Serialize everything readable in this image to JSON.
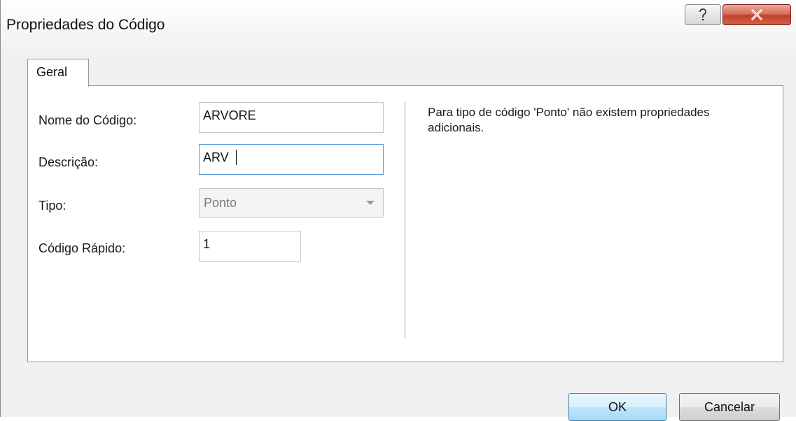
{
  "window": {
    "title": "Propriedades do Código",
    "help_icon": "question-mark-icon",
    "close_icon": "close-x-icon"
  },
  "tabs": [
    {
      "label": "Geral",
      "active": true
    }
  ],
  "form": {
    "nome_label": "Nome do Código:",
    "nome_value": "ARVORE",
    "descricao_label": "Descrição:",
    "descricao_value": "ARV",
    "tipo_label": "Tipo:",
    "tipo_value": "Ponto",
    "rapido_label": "Código Rápido:",
    "rapido_value": "1"
  },
  "info_text": "Para tipo de código 'Ponto' não existem propriedades adicionais.",
  "buttons": {
    "ok": "OK",
    "cancel": "Cancelar"
  },
  "colors": {
    "close_button": "#c4402a",
    "focus_border": "#5b9bd5",
    "default_button": "#3c7fb1"
  }
}
